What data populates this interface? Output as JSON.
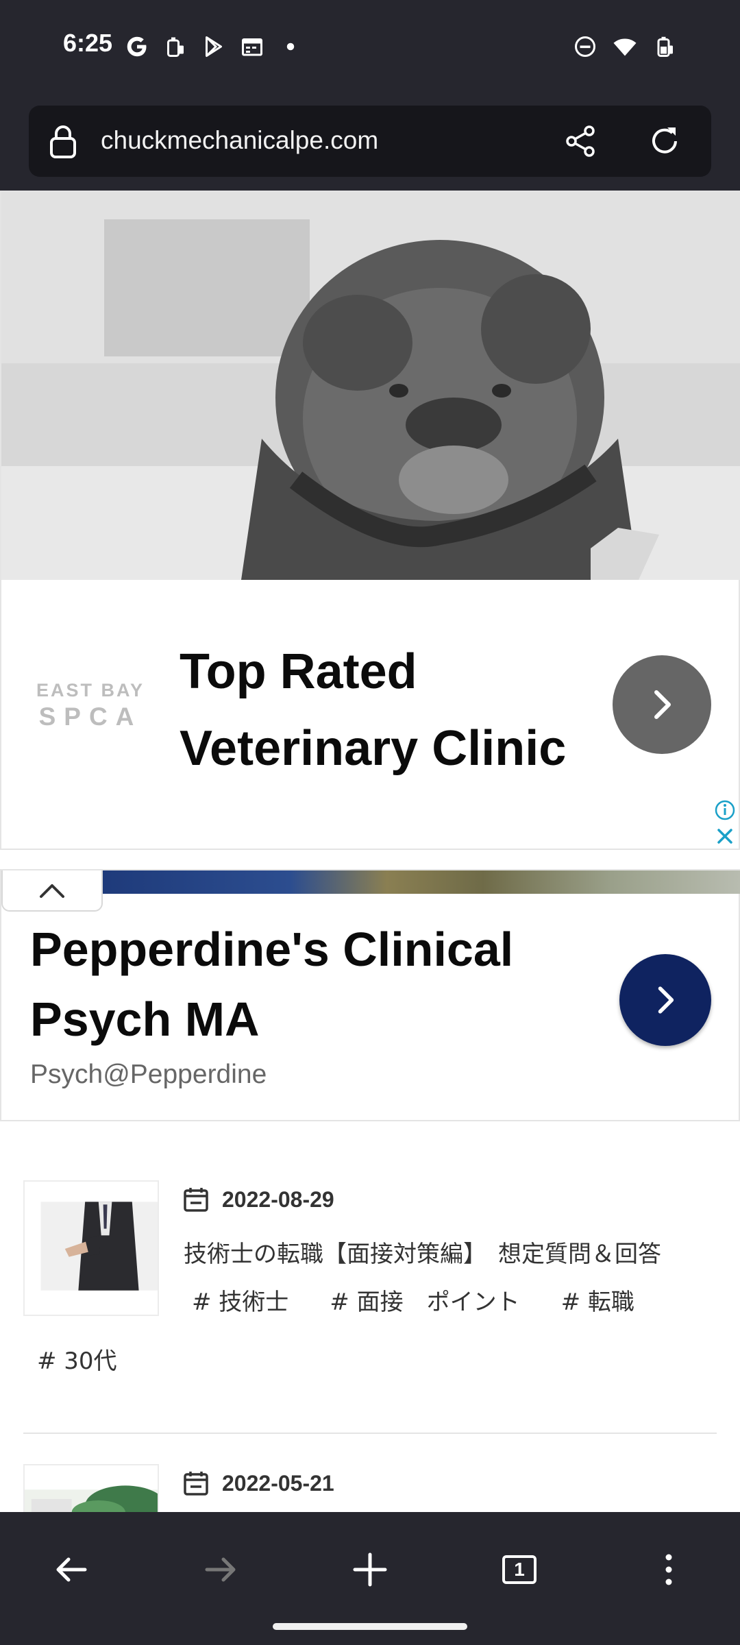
{
  "status_bar": {
    "time": "6:25",
    "left_icons": [
      "google-icon",
      "briefcase-icon",
      "play-store-icon",
      "calendar-icon",
      "dot-icon"
    ],
    "right_icons": [
      "do-not-disturb-icon",
      "wifi-icon",
      "battery-icon"
    ]
  },
  "browser": {
    "url": "chuckmechanicalpe.com"
  },
  "ad1": {
    "brand_line1": "EAST BAY",
    "brand_line2": "SPCA",
    "headline_line1": "Top Rated",
    "headline_line2": "Veterinary Clinic"
  },
  "ad2": {
    "headline_line1": "Pepperdine's Clinical",
    "headline_line2": "Psych MA",
    "advertiser": "Psych@Pepperdine"
  },
  "articles": [
    {
      "date": "2022-08-29",
      "title": "技術士の転職【面接対策編】　想定質問＆回答",
      "tags": [
        "# 技術士",
        "# 面接　ポイント",
        "# 転職"
      ],
      "tag_extra": "# 30代"
    },
    {
      "date": "2022-05-21"
    }
  ],
  "toolbar": {
    "tab_count": "1"
  },
  "colors": {
    "chrome_bg": "#26262e",
    "url_field_bg": "#16161b",
    "ad2_button": "#0f2360",
    "ad1_button": "#666666"
  }
}
